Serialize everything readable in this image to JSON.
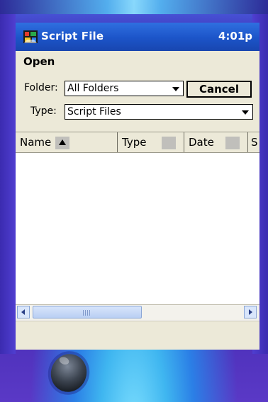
{
  "window": {
    "title": "Script File",
    "time": "4:01p",
    "app_icon": "colorful-scroll-icon"
  },
  "menu": {
    "open_label": "Open"
  },
  "form": {
    "folder_label": "Folder:",
    "folder_value": "All Folders",
    "type_label": "Type:",
    "type_value": "Script Files",
    "cancel_label": "Cancel"
  },
  "list": {
    "columns": [
      {
        "label": "Name",
        "sort": "ascending"
      },
      {
        "label": "Type"
      },
      {
        "label": "Date"
      },
      {
        "label": "S"
      }
    ],
    "rows": []
  },
  "icons": {
    "dropdown": "chevron-down-icon",
    "sort": "sort-up-icon",
    "scroll_left": "scroll-left-icon",
    "scroll_right": "scroll-right-icon"
  },
  "colors": {
    "titlebar": "#1c54c8",
    "chrome": "#ece9d8",
    "device": "#3a2aa8"
  }
}
